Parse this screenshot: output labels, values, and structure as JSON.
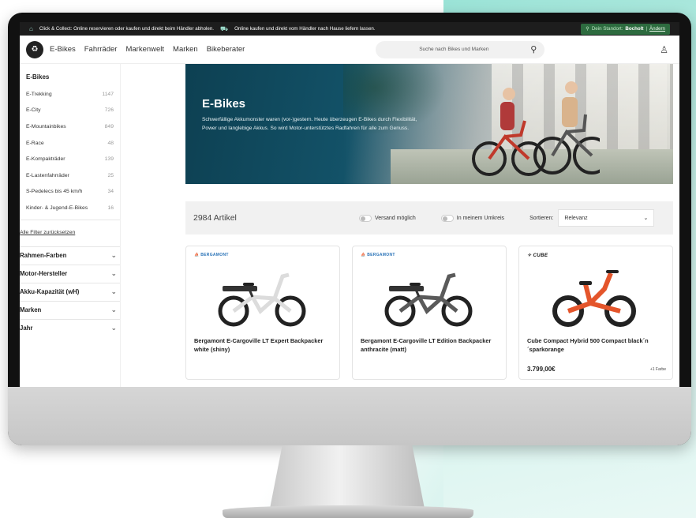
{
  "topbar": {
    "click_collect": "Click & Collect: Online reservieren oder kaufen und direkt beim Händler abholen.",
    "delivery": "Online kaufen und direkt vom Händler nach Hause liefern lassen.",
    "location_prefix": "Dein Standort:",
    "location_city": "Bocholt",
    "location_sep": "|",
    "location_change": "Ändern"
  },
  "nav": {
    "logo_glyph": "♻",
    "links": [
      "E-Bikes",
      "Fahrräder",
      "Markenwelt",
      "Marken",
      "Bikeberater"
    ],
    "search_placeholder": "Suche nach Bikes und Marken"
  },
  "sidebar": {
    "heading": "E-Bikes",
    "categories": [
      {
        "label": "E-Trekking",
        "count": "1147"
      },
      {
        "label": "E-City",
        "count": "726"
      },
      {
        "label": "E-Mountainbikes",
        "count": "849"
      },
      {
        "label": "E-Race",
        "count": "48"
      },
      {
        "label": "E-Kompakträder",
        "count": "139"
      },
      {
        "label": "E-Lastenfahrräder",
        "count": "25"
      },
      {
        "label": "S-Pedelecs bis 45 km/h",
        "count": "34"
      },
      {
        "label": "Kinder- & Jugend-E-Bikes",
        "count": "16"
      }
    ],
    "reset": "Alle Filter zurücksetzen",
    "filters": [
      "Rahmen-Farben",
      "Motor-Hersteller",
      "Akku-Kapazität (wH)",
      "Marken",
      "Jahr"
    ]
  },
  "hero": {
    "title": "E-Bikes",
    "text": "Schwerfällige Akkumonster waren (vor-)gestern. Heute überzeugen E-Bikes durch Flexibilität, Power und langlebige Akkus. So wird Motor-unterstütztes Radfahren für alle zum Genuss."
  },
  "toolbar": {
    "count": "2984 Artikel",
    "toggle_shipping": "Versand möglich",
    "toggle_nearby": "In meinem Umkreis",
    "sort_label": "Sortieren:",
    "sort_value": "Relevanz"
  },
  "products": [
    {
      "brand": "BERGAMONT",
      "name": "Bergamont E-Cargoville LT Expert Backpacker white (shiny)",
      "price": "",
      "colors": "",
      "frame_color": "#dcdcdc"
    },
    {
      "brand": "BERGAMONT",
      "name": "Bergamont E-Cargoville LT Edition Backpacker anthracite (matt)",
      "price": "",
      "colors": "",
      "frame_color": "#5a5a5a"
    },
    {
      "brand": "CUBE",
      "name": "Cube Compact Hybrid 500 Compact black´n ´sparkorange",
      "price": "3.799,00€",
      "colors": "+1 Farbe",
      "frame_color": "#e4552b"
    }
  ],
  "colors": {
    "accent": "#9ad9c9",
    "hero_bg": "#135268",
    "location_bg": "#2d6b3f"
  }
}
